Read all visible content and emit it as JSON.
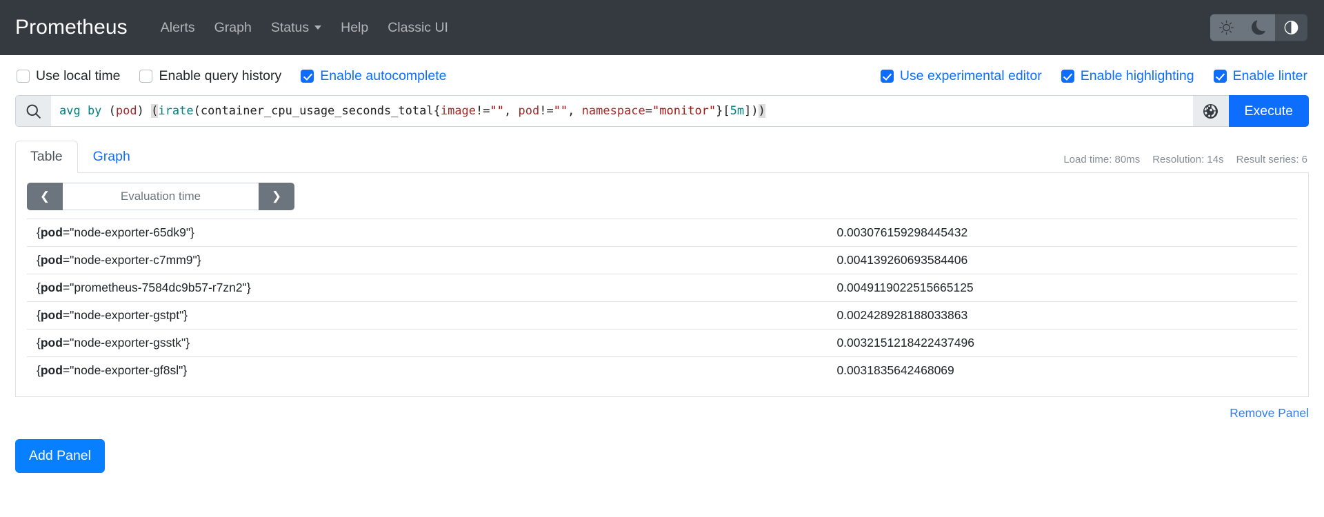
{
  "navbar": {
    "brand": "Prometheus",
    "links": [
      {
        "label": "Alerts",
        "has_caret": false
      },
      {
        "label": "Graph",
        "has_caret": false
      },
      {
        "label": "Status",
        "has_caret": true
      },
      {
        "label": "Help",
        "has_caret": false
      },
      {
        "label": "Classic UI",
        "has_caret": false
      }
    ],
    "themes": [
      {
        "name": "sun-icon",
        "label": "Light theme",
        "active": false
      },
      {
        "name": "moon-icon",
        "label": "Dark theme",
        "active": false
      },
      {
        "name": "half-circle-icon",
        "label": "Auto theme",
        "active": true
      }
    ]
  },
  "options": {
    "left": [
      {
        "label": "Use local time",
        "checked": false
      },
      {
        "label": "Enable query history",
        "checked": false
      },
      {
        "label": "Enable autocomplete",
        "checked": true
      }
    ],
    "right": [
      {
        "label": "Use experimental editor",
        "checked": true
      },
      {
        "label": "Enable highlighting",
        "checked": true
      },
      {
        "label": "Enable linter",
        "checked": true
      }
    ]
  },
  "query": {
    "text": "avg by (pod) (irate(container_cpu_usage_seconds_total{image!=\"\", pod!=\"\", namespace=\"monitor\"}[5m]))",
    "tokens": [
      {
        "t": "avg by",
        "c": "kw"
      },
      {
        "t": " ",
        "c": "plain"
      },
      {
        "t": "(",
        "c": "paren"
      },
      {
        "t": "pod",
        "c": "lbl"
      },
      {
        "t": ")",
        "c": "paren"
      },
      {
        "t": " ",
        "c": "plain"
      },
      {
        "t": "(",
        "c": "paren match"
      },
      {
        "t": "irate",
        "c": "fn"
      },
      {
        "t": "(",
        "c": "paren"
      },
      {
        "t": "container_cpu_usage_seconds_total",
        "c": "plain"
      },
      {
        "t": "{",
        "c": "paren"
      },
      {
        "t": "image",
        "c": "lbl"
      },
      {
        "t": "!=",
        "c": "plain"
      },
      {
        "t": "\"\"",
        "c": "str"
      },
      {
        "t": ", ",
        "c": "plain"
      },
      {
        "t": "pod",
        "c": "lbl"
      },
      {
        "t": "!=",
        "c": "plain"
      },
      {
        "t": "\"\"",
        "c": "str"
      },
      {
        "t": ", ",
        "c": "plain"
      },
      {
        "t": "namespace",
        "c": "lbl"
      },
      {
        "t": "=",
        "c": "plain"
      },
      {
        "t": "\"monitor\"",
        "c": "str"
      },
      {
        "t": "}",
        "c": "paren"
      },
      {
        "t": "[",
        "c": "paren"
      },
      {
        "t": "5m",
        "c": "dur"
      },
      {
        "t": "]",
        "c": "paren"
      },
      {
        "t": ")",
        "c": "paren"
      },
      {
        "t": ")",
        "c": "paren match"
      }
    ],
    "search_icon": "search-icon",
    "globe_icon": "globe-icon",
    "execute_label": "Execute"
  },
  "tabs": [
    {
      "label": "Table",
      "active": true
    },
    {
      "label": "Graph",
      "active": false
    }
  ],
  "meta": {
    "load_time": "Load time: 80ms",
    "resolution": "Resolution: 14s",
    "result_series": "Result series: 6"
  },
  "evaluation": {
    "prev_label": "❮",
    "next_label": "❯",
    "placeholder": "Evaluation time",
    "value": ""
  },
  "results": {
    "rows": [
      {
        "metric_open": "{",
        "metric_key": "pod",
        "metric_eq": "=",
        "metric_val": "\"node-exporter-65dk9\"",
        "metric_close": "}",
        "value": "0.003076159298445432"
      },
      {
        "metric_open": "{",
        "metric_key": "pod",
        "metric_eq": "=",
        "metric_val": "\"node-exporter-c7mm9\"",
        "metric_close": "}",
        "value": "0.004139260693584406"
      },
      {
        "metric_open": "{",
        "metric_key": "pod",
        "metric_eq": "=",
        "metric_val": "\"prometheus-7584dc9b57-r7zn2\"",
        "metric_close": "}",
        "value": "0.0049119022515665125"
      },
      {
        "metric_open": "{",
        "metric_key": "pod",
        "metric_eq": "=",
        "metric_val": "\"node-exporter-gstpt\"",
        "metric_close": "}",
        "value": "0.002428928188033863"
      },
      {
        "metric_open": "{",
        "metric_key": "pod",
        "metric_eq": "=",
        "metric_val": "\"node-exporter-gsstk\"",
        "metric_close": "}",
        "value": "0.0032151218422437496"
      },
      {
        "metric_open": "{",
        "metric_key": "pod",
        "metric_eq": "=",
        "metric_val": "\"node-exporter-gf8sl\"",
        "metric_close": "}",
        "value": "0.0031835642468069"
      }
    ]
  },
  "footer": {
    "remove_panel": "Remove Panel",
    "add_panel": "Add Panel"
  },
  "colors": {
    "navbar_bg": "#343a40",
    "accent_blue": "#0d6efd",
    "add_panel_blue": "#087fff",
    "muted": "#868e96",
    "border": "#dee2e6"
  }
}
